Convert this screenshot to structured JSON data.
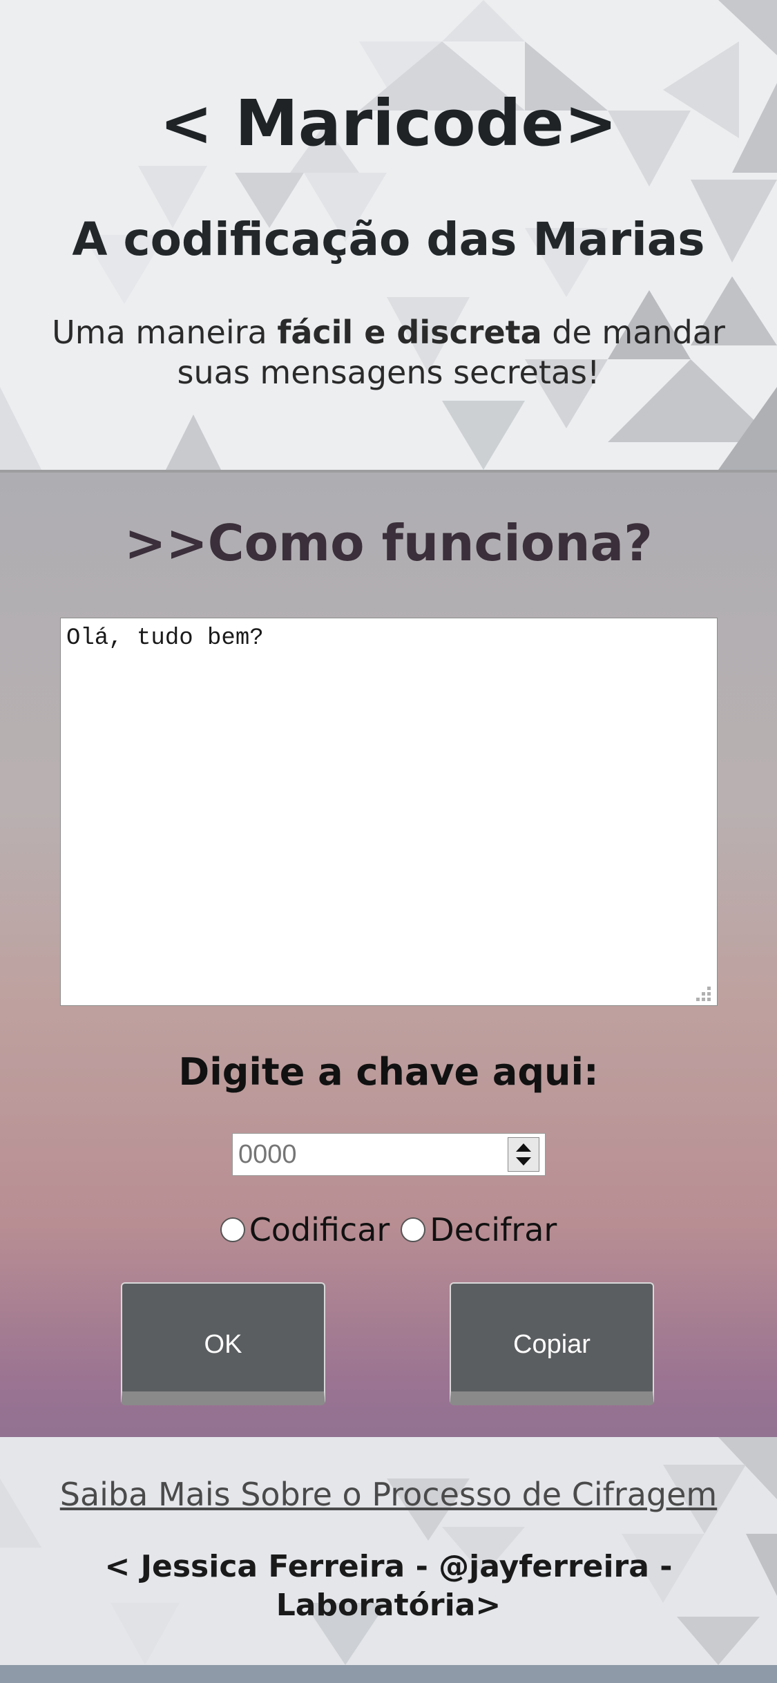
{
  "header": {
    "title": "< Maricode>",
    "subtitle": "A codificação das Marias",
    "tagline_start": "Uma maneira ",
    "tagline_bold": "fácil e discreta",
    "tagline_end": " de mandar suas mensagens secretas!"
  },
  "main": {
    "heading": ">>Como funciona?",
    "message_value": "Olá, tudo bem?",
    "key_label": "Digite a chave aqui:",
    "key_placeholder": "0000",
    "radio_encode": "Codificar",
    "radio_decode": "Decifrar",
    "ok_label": "OK",
    "copy_label": "Copiar"
  },
  "footer": {
    "learn_more": "Saiba Mais Sobre o Processo de Cifragem",
    "credits": "< Jessica Ferreira - @jayferreira - Laboratória>"
  },
  "colors": {
    "title_text": "#1f2326",
    "heading_text": "#3a2f3a",
    "button_bg": "#5b5e60",
    "gradient_top": "#aeaeb2",
    "gradient_bottom": "#927191"
  }
}
